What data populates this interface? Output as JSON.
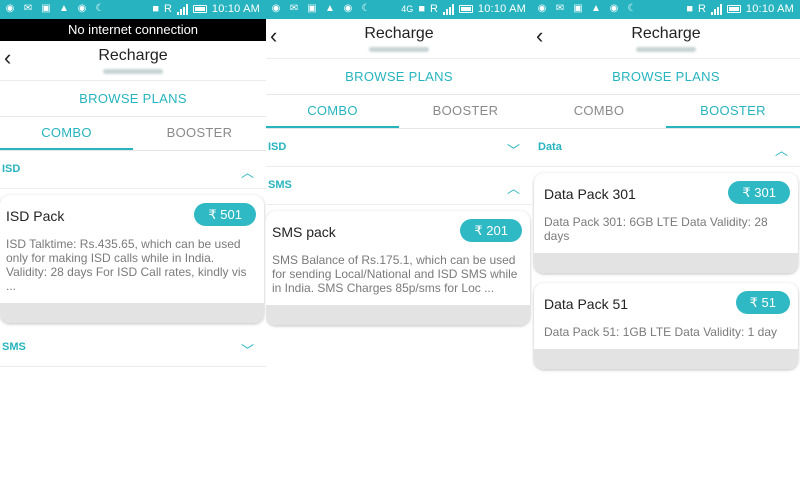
{
  "status_bar": {
    "time": "10:10 AM",
    "net": "4G",
    "r_badge": "R"
  },
  "panel1": {
    "banner": "No internet connection",
    "title": "Recharge",
    "browse": "BROWSE PLANS",
    "tabs": [
      "COMBO",
      "BOOSTER"
    ],
    "sections": [
      {
        "label": "ISD",
        "chevron": "up"
      },
      {
        "label": "SMS",
        "chevron": "down"
      }
    ],
    "card": {
      "name": "ISD Pack",
      "price": "₹ 501",
      "desc": "ISD Talktime: Rs.435.65, which can be used only for making ISD calls while in India. Validity: 28 days For ISD Call rates, kindly vis ..."
    }
  },
  "panel2": {
    "title": "Recharge",
    "browse": "BROWSE PLANS",
    "tabs": [
      "COMBO",
      "BOOSTER"
    ],
    "sections": [
      {
        "label": "ISD",
        "chevron": "down"
      },
      {
        "label": "SMS",
        "chevron": "up"
      }
    ],
    "card": {
      "name": "SMS pack",
      "price": "₹ 201",
      "desc": "SMS Balance of Rs.175.1, which can be used for sending Local/National and ISD SMS while in India. SMS Charges 85p/sms for Loc ..."
    }
  },
  "panel3": {
    "title": "Recharge",
    "browse": "BROWSE PLANS",
    "tabs": [
      "COMBO",
      "BOOSTER"
    ],
    "sections": [
      {
        "label": "Data",
        "chevron": "up"
      }
    ],
    "cards": [
      {
        "name": "Data Pack 301",
        "price": "₹ 301",
        "desc": "Data Pack 301: 6GB LTE Data Validity: 28 days"
      },
      {
        "name": "Data Pack 51",
        "price": "₹ 51",
        "desc": "Data Pack 51: 1GB LTE Data Validity: 1 day"
      }
    ]
  },
  "colors": {
    "accent": "#27b4c0",
    "price_pill": "#2fb9c4",
    "banner": "#000000"
  }
}
